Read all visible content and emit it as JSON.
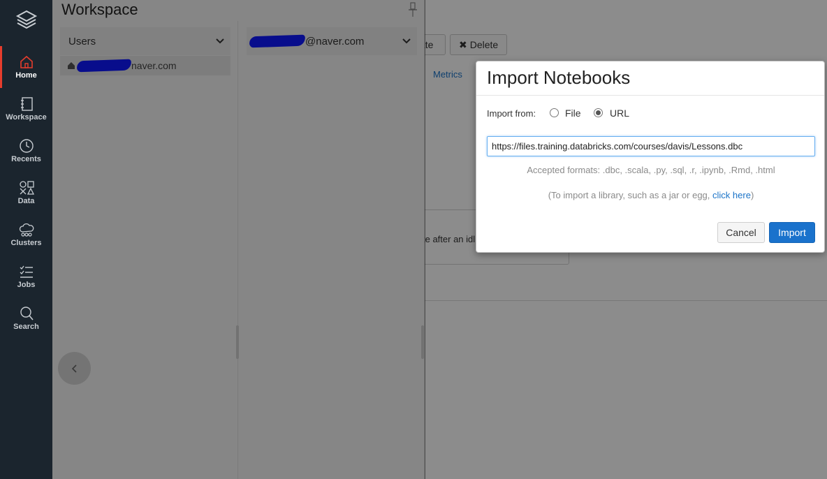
{
  "nav": {
    "items": [
      {
        "label": "Home",
        "icon": "home-icon"
      },
      {
        "label": "Workspace",
        "icon": "notebook-icon"
      },
      {
        "label": "Recents",
        "icon": "clock-icon"
      },
      {
        "label": "Data",
        "icon": "data-shapes-icon"
      },
      {
        "label": "Clusters",
        "icon": "cloud-icon"
      },
      {
        "label": "Jobs",
        "icon": "checklist-icon"
      },
      {
        "label": "Search",
        "icon": "search-icon"
      }
    ],
    "active_color": "#e63d2d"
  },
  "background": {
    "create_btn_fragment": "ate",
    "delete_btn": "Delete",
    "metrics_tab": "Metrics",
    "idle_text_fragment": "te after an idl"
  },
  "workspace": {
    "title": "Workspace",
    "col1_header": "Users",
    "col1_row_suffix": "naver.com",
    "col2_header_suffix": "@naver.com"
  },
  "modal": {
    "title": "Import Notebooks",
    "import_from_label": "Import from:",
    "option_file": "File",
    "option_url": "URL",
    "selected_option": "URL",
    "url_value": "https://files.training.databricks.com/courses/davis/Lessons.dbc",
    "accepted_formats": "Accepted formats: .dbc, .scala, .py, .sql, .r, .ipynb, .Rmd, .html",
    "library_note_prefix": "(To import a library, such as a jar or egg, ",
    "library_note_link": "click here",
    "library_note_suffix": ")",
    "cancel_label": "Cancel",
    "import_label": "Import",
    "primary_color": "#1a72cc"
  }
}
